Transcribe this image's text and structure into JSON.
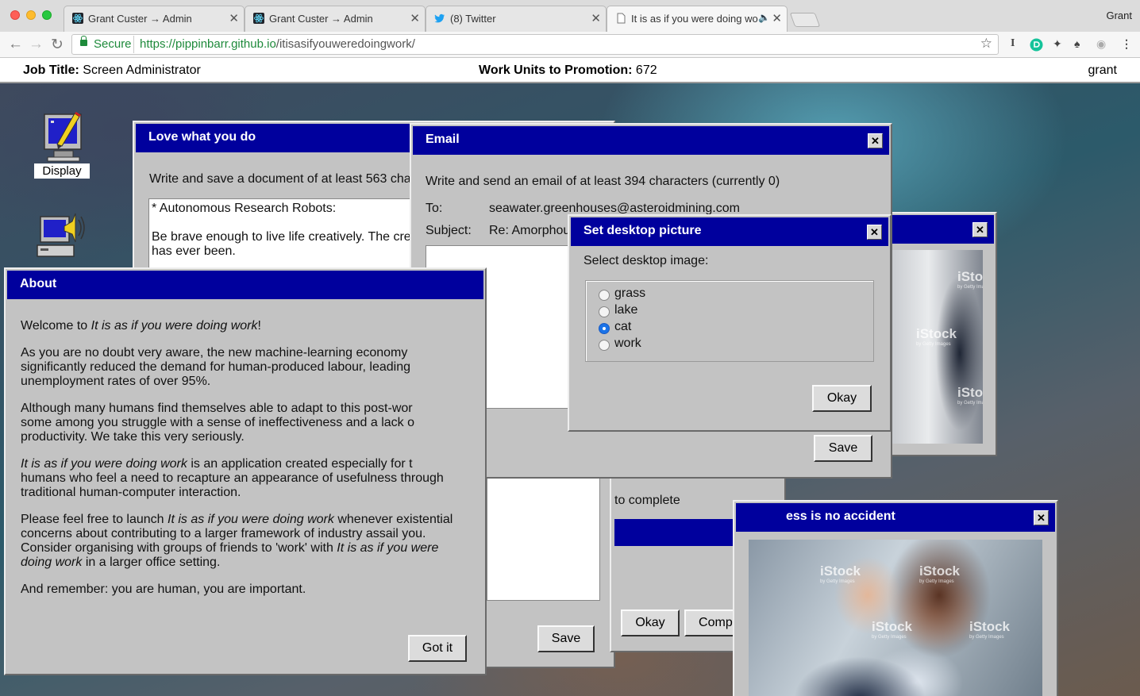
{
  "browser": {
    "profile_name": "Grant",
    "tabs": [
      {
        "title": "Grant Custer → Admin",
        "favicon": "react-icon"
      },
      {
        "title": "Grant Custer → Admin",
        "favicon": "react-icon"
      },
      {
        "title": "(8) Twitter",
        "favicon": "twitter-icon"
      },
      {
        "title": "It is as if you were doing wo",
        "favicon": "page-icon",
        "audio": "🔈"
      }
    ],
    "tab_close": "✕",
    "secure_label": "Secure",
    "url_base": "https://pippinbarr.github.io",
    "url_path": "/itisasifyouweredoingwork/"
  },
  "app": {
    "job_title_label": "Job Title:",
    "job_title_value": "Screen Administrator",
    "promotion_label": "Work Units to Promotion:",
    "promotion_value": "672",
    "username": "grant"
  },
  "desktop_icons": [
    {
      "label": "Display",
      "icon": "display-icon"
    },
    {
      "label": "",
      "icon": "sound-icon"
    }
  ],
  "windows": {
    "love": {
      "title": "Love what you do",
      "instruction": "Write and save a document of at least 563 cha",
      "doc_line1": "* Autonomous Research Robots:",
      "doc_line2": "Be brave enough to live life creatively. The cre",
      "doc_line3": "has ever been.",
      "save": "Save"
    },
    "about": {
      "title": "About",
      "p1_a": "Welcome to ",
      "p1_b": "It is as if you were doing work",
      "p1_c": "!",
      "p2_l1": "As you are no doubt very aware, the new machine-learning economy",
      "p2_l2": "significantly reduced the demand for human-produced labour, leading",
      "p2_l3": "unemployment rates of over 95%.",
      "p3_l1": "Although many humans find themselves able to adapt to this post-wor",
      "p3_l2": "some among you struggle with a sense of ineffectiveness and a lack o",
      "p3_l3": "productivity. We take this very seriously.",
      "p4_l1a": "It is as if you were doing work",
      "p4_l1b": " is an application created especially for t",
      "p4_l2": "humans who feel a need to recapture an appearance of usefulness through",
      "p4_l3": "traditional human-computer interaction.",
      "p5_l1a": "Please feel free to launch ",
      "p5_l1b": "It is as if you were doing work",
      "p5_l1c": " whenever existential",
      "p5_l2": "concerns about contributing to a larger framework of industry assail you.",
      "p5_l3a": "Consider organising with groups of friends to 'work' with ",
      "p5_l3b": "It is as if you were",
      "p5_l4a": "doing work",
      "p5_l4b": " in a larger office setting.",
      "p6": "And remember: you are human, you are important.",
      "button": "Got it"
    },
    "compute": {
      "partial_text": "to complete",
      "okay": "Okay",
      "compute": "Compute"
    },
    "email": {
      "title": "Email",
      "instruction": "Write and send an email of at least 394 characters (currently 0)",
      "to_label": "To:",
      "to_value": "seawater.greenhouses@asteroidmining.com",
      "subject_label": "Subject:",
      "subject_value": "Re: Amorphou",
      "send": "Save",
      "close": "✕"
    },
    "desktop_picture": {
      "title": "Set desktop picture",
      "prompt": "Select desktop image:",
      "options": [
        "grass",
        "lake",
        "cat",
        "work"
      ],
      "selected": "cat",
      "okay": "Okay",
      "close": "✕"
    },
    "photo_right": {
      "close": "✕",
      "save": "Save",
      "watermark": "iStock",
      "watermark_sub": "by Getty Images"
    },
    "success": {
      "title": "ess is no accident",
      "close": "✕"
    }
  }
}
